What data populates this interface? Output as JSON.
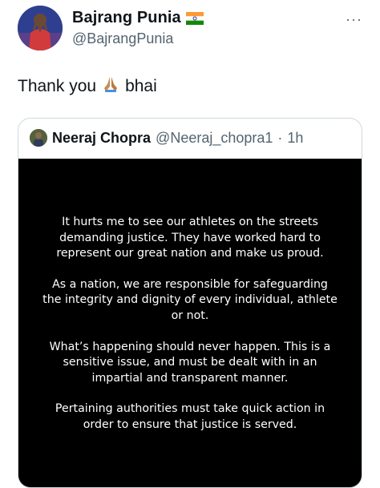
{
  "tweet": {
    "author_name": "Bajrang Punia",
    "author_handle": "@BajrangPunia",
    "text": "Thank you",
    "text_suffix": "bhai",
    "more_label": "···"
  },
  "icons": {
    "author_flag": "india-flag-icon",
    "emoji": "folded-hands-icon",
    "more": "more-options-icon"
  },
  "quoted_tweet": {
    "author_name": "Neeraj Chopra",
    "author_handle": "@Neeraj_chopra1",
    "separator": "·",
    "time": "1h",
    "statement": {
      "paragraph_1": "It hurts me to see our athletes on the streets demanding justice. They have worked hard to represent our great nation and make us proud.",
      "paragraph_2": "As a nation, we are responsible for safeguarding the integrity and dignity of every individual, athlete or not.",
      "paragraph_3": "What’s happening should never happen. This is a sensitive issue, and must be dealt with in an impartial and transparent manner.",
      "paragraph_4": "Pertaining authorities must take quick action in order to ensure that justice is served."
    }
  },
  "colors": {
    "text_primary": "#0f1419",
    "text_secondary": "#536471",
    "border": "#cfd9de",
    "media_background": "#000000"
  }
}
